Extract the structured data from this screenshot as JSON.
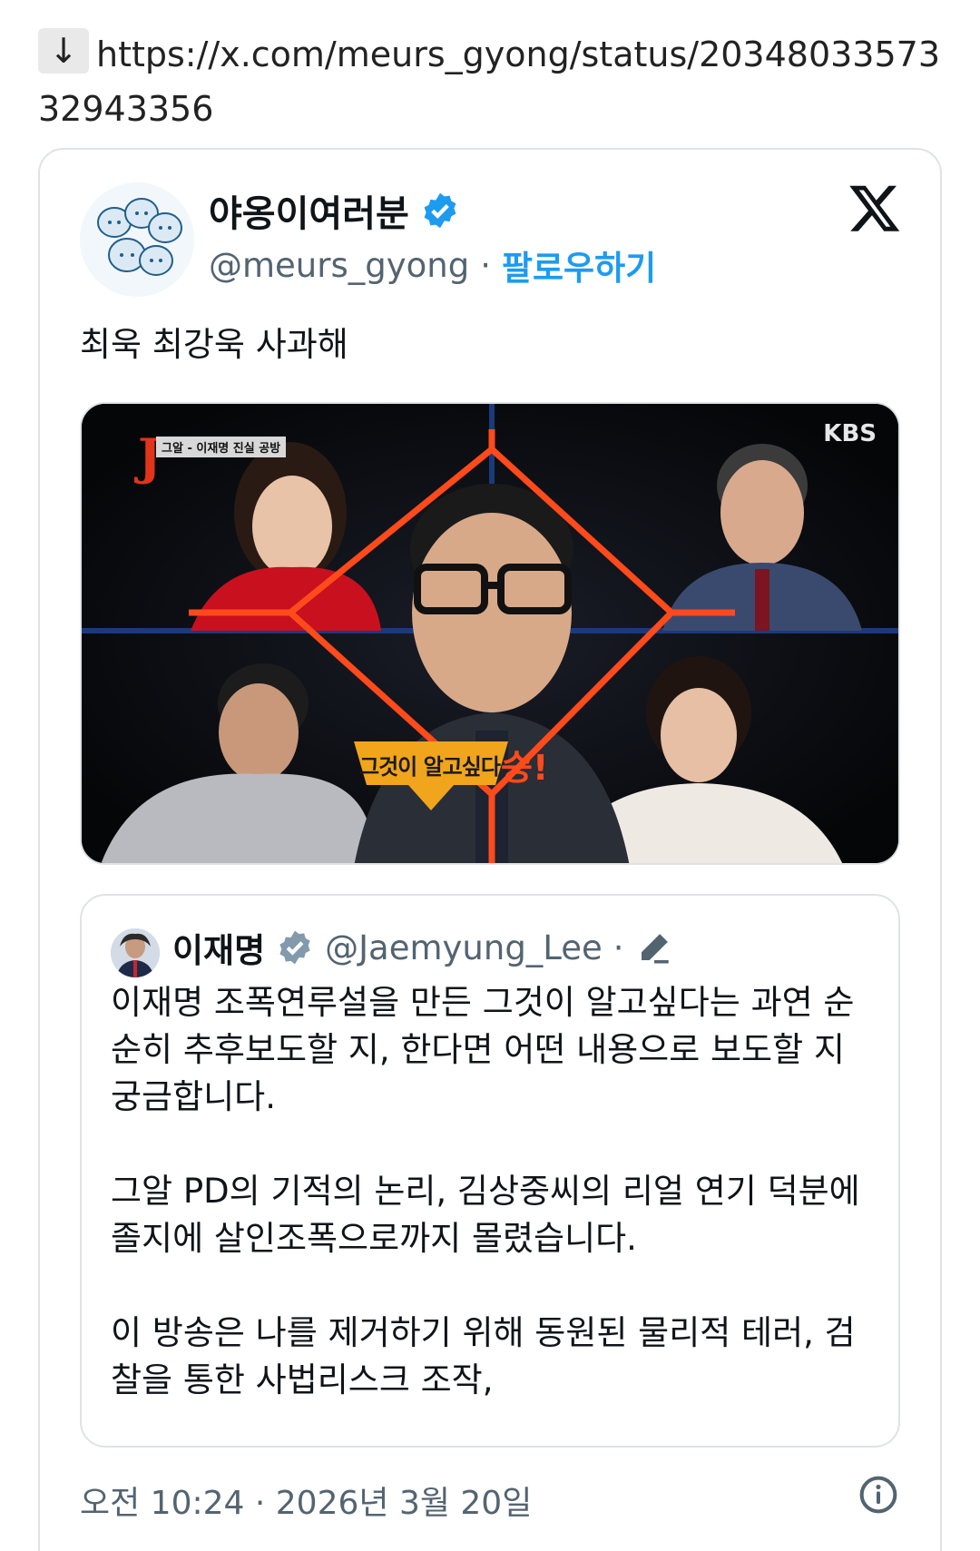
{
  "link": {
    "arrow": "↓",
    "url": "https://x.com/meurs_gyong/status/2034803357332943356"
  },
  "tweet": {
    "display_name": "야옹이여러분",
    "handle": "@meurs_gyong",
    "separator": "·",
    "follow_label": "팔로우하기",
    "text": "최욱 최강욱 사과해",
    "media": {
      "top_left_caption": "그알 - 이재명 진실 공방",
      "logo_letter": "J",
      "network": "KBS",
      "banner_text": "그것이 알고싶다",
      "banner_suffix": "승!"
    },
    "quote": {
      "name": "이재명",
      "handle": "@Jaemyung_Lee",
      "dot": "·",
      "paragraphs": [
        "이재명 조폭연루설을 만든 그것이 알고싶다는 과연 순순히 추후보도할 지, 한다면 어떤 내용으로 보도할 지 궁금합니다.",
        "그알 PD의 기적의 논리, 김상중씨의 리얼 연기 덕분에 졸지에 살인조폭으로까지 몰렸습니다.",
        "이 방송은 나를 제거하기 위해 동원된 물리적 테러, 검찰을 통한 사법리스크 조작,"
      ]
    },
    "timestamp": "오전 10:24 · 2026년 3월 20일"
  },
  "colors": {
    "accent": "#1d9bf0",
    "muted": "#536471",
    "border": "#dfe3e6",
    "frame_orange": "#ff4a1c"
  },
  "icons": {
    "verified": "verified-badge-icon",
    "x_logo": "x-logo-icon",
    "edit": "edit-pencil-icon",
    "info": "info-icon",
    "arrow": "down-arrow-icon"
  }
}
